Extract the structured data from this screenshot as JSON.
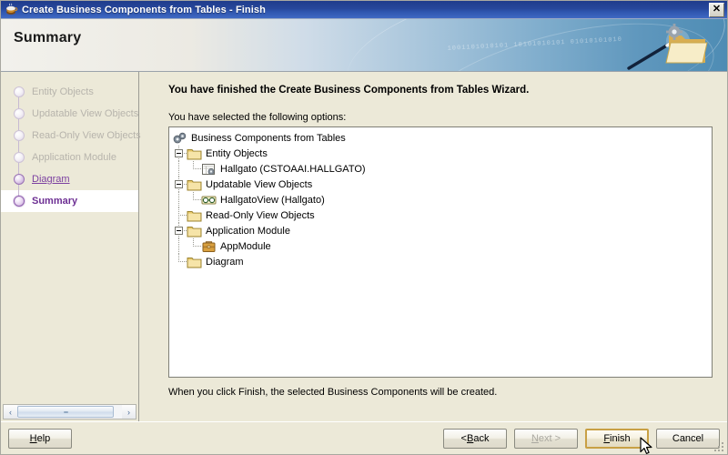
{
  "window": {
    "title": "Create Business Components from Tables - Finish",
    "title_icon": "java-coffee-cup-icon",
    "close_label": "✕"
  },
  "banner": {
    "title": "Summary",
    "art_icon": "folder-wand-gear-icon",
    "decoration_bits": "1001101010101 10101010101\n01010101010"
  },
  "sidebar": {
    "steps": [
      {
        "label": "Entity Objects",
        "state": "done"
      },
      {
        "label": "Updatable View Objects",
        "state": "done"
      },
      {
        "label": "Read-Only View Objects",
        "state": "done"
      },
      {
        "label": "Application Module",
        "state": "done"
      },
      {
        "label": "Diagram",
        "state": "visited"
      },
      {
        "label": "Summary",
        "state": "current"
      }
    ],
    "scrollbar": {
      "left_arrow": "‹",
      "right_arrow": "›"
    }
  },
  "main": {
    "heading": "You have finished the Create Business Components from Tables Wizard.",
    "sub_label": "You have selected the following options:",
    "footnote": "When you click Finish, the selected Business Components will be created.",
    "tree": [
      {
        "label": "Business Components from Tables",
        "icon": "bc-root-icon",
        "indent": 0,
        "toggle": "none",
        "last": false
      },
      {
        "label": "Entity Objects",
        "icon": "folder-icon",
        "indent": 1,
        "toggle": "expanded",
        "last": false
      },
      {
        "label": "Hallgato (CSTOAAI.HALLGATO)",
        "icon": "entity-object-icon",
        "indent": 2,
        "toggle": "none",
        "last": true
      },
      {
        "label": "Updatable View Objects",
        "icon": "folder-icon",
        "indent": 1,
        "toggle": "expanded",
        "last": false
      },
      {
        "label": "HallgatoView (Hallgato)",
        "icon": "view-object-icon",
        "indent": 2,
        "toggle": "none",
        "last": true
      },
      {
        "label": "Read-Only View Objects",
        "icon": "folder-icon",
        "indent": 1,
        "toggle": "none",
        "last": false
      },
      {
        "label": "Application Module",
        "icon": "folder-icon",
        "indent": 1,
        "toggle": "expanded",
        "last": false
      },
      {
        "label": "AppModule",
        "icon": "briefcase-icon",
        "indent": 2,
        "toggle": "none",
        "last": true
      },
      {
        "label": "Diagram",
        "icon": "folder-icon",
        "indent": 1,
        "toggle": "none",
        "last": true
      }
    ]
  },
  "buttons": {
    "help": {
      "label": "Help",
      "accel": "H",
      "enabled": true,
      "default": false
    },
    "back": {
      "label": "< Back",
      "accel": "B",
      "enabled": true,
      "default": false
    },
    "next": {
      "label": "Next >",
      "accel": "N",
      "enabled": false,
      "default": false
    },
    "finish": {
      "label": "Finish",
      "accel": "F",
      "enabled": true,
      "default": true
    },
    "cancel": {
      "label": "Cancel",
      "accel": "",
      "enabled": true,
      "default": false
    }
  },
  "colors": {
    "titlebar": "#27479b",
    "dialog_face": "#ece9d8",
    "accent_purple": "#6d2f93",
    "link_purple": "#7b3fa0",
    "default_button_border": "#c8a045",
    "folder_yellow": "#e9c96a"
  }
}
